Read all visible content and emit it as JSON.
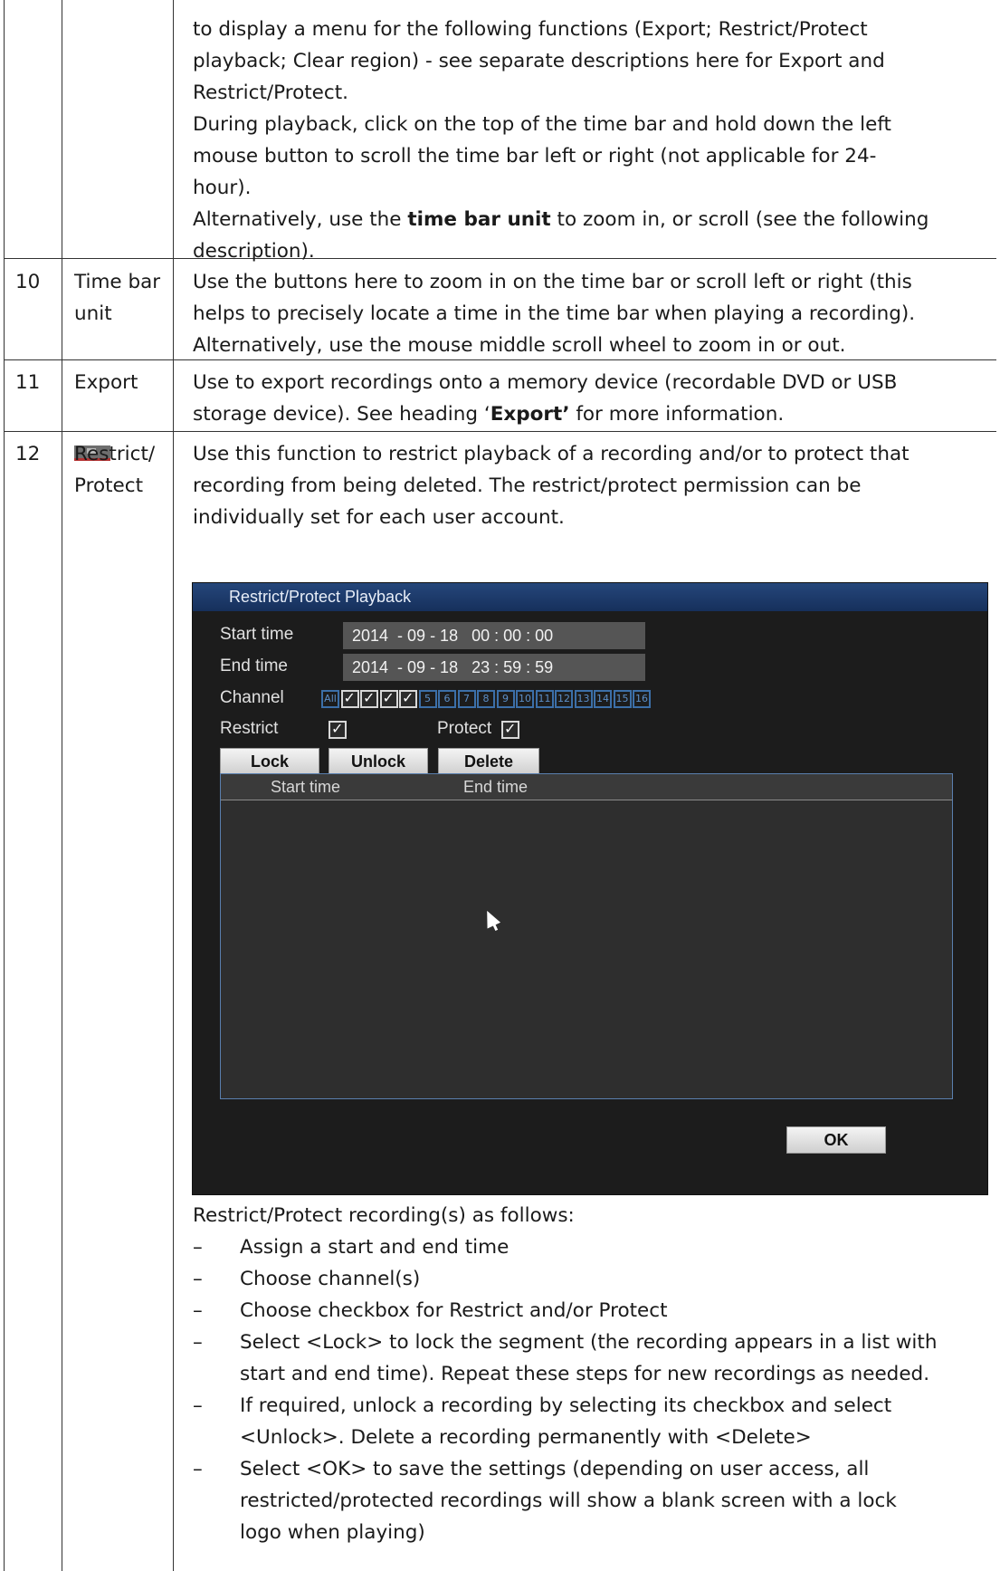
{
  "top_block": {
    "lines": [
      "to display a menu for the following functions (Export; Restrict/Protect",
      "playback; Clear region) - see separate descriptions here for Export and",
      "Restrict/Protect.",
      "During playback, click on the top of the time bar and hold down the left",
      "mouse button to scroll the time bar left or right (not applicable for 24-",
      "hour)."
    ],
    "alt_prefix": "Alternatively, use the ",
    "alt_bold": "time bar unit",
    "alt_suffix": " to zoom in, or scroll (see the following",
    "alt_line2": "description)."
  },
  "rows": [
    {
      "num": "10",
      "name": "Time bar unit",
      "lines": [
        "Use the buttons here to zoom in on the time bar or scroll left or right (this",
        "helps to precisely locate a time in the time bar when playing a recording).",
        "Alternatively, use the mouse middle scroll wheel to zoom in or out."
      ]
    },
    {
      "num": "11",
      "name": "Export",
      "icon": "export-icon",
      "line1": "Use to export recordings onto a memory device (recordable DVD or USB",
      "line2_prefix": "storage device). See heading ‘",
      "line2_bold": "Export’",
      "line2_suffix": " for more information."
    },
    {
      "num": "12",
      "name": "Restrict/ Protect",
      "lines": [
        "Use this function to restrict playback of a recording and/or to protect that",
        "recording from being deleted. The restrict/protect permission can be",
        "individually set for each user account."
      ]
    }
  ],
  "dialog": {
    "title": "Restrict/Protect Playback",
    "start_label": "Start time",
    "start_value": "2014  - 09 - 18   00 : 00 : 00",
    "end_label": "End time",
    "end_value": "2014  - 09 - 18   23 : 59 : 59",
    "channel_label": "Channel",
    "channel_all": "All",
    "channels_checked": 4,
    "channel_numbers": [
      "5",
      "6",
      "7",
      "8",
      "9",
      "10",
      "11",
      "12",
      "13",
      "14",
      "15",
      "16"
    ],
    "restrict_label": "Restrict",
    "restrict_checked": true,
    "protect_label": "Protect",
    "protect_checked": true,
    "lock_button": "Lock",
    "unlock_button": "Unlock",
    "delete_button": "Delete",
    "col_start": "Start time",
    "col_end": "End time",
    "ok_button": "OK"
  },
  "after_dialog": {
    "intro": "Restrict/Protect recording(s) as follows:",
    "bullets": [
      [
        "Assign a start and end time"
      ],
      [
        "Choose channel(s)"
      ],
      [
        "Choose checkbox for Restrict and/or Protect"
      ],
      [
        "Select <Lock> to lock the segment (the recording appears in a list with",
        "start and end time). Repeat these steps for new recordings as needed."
      ],
      [
        "If required, unlock a recording by selecting its checkbox and select",
        "<Unlock>. Delete a recording permanently with <Delete>"
      ],
      [
        "Select <OK> to save the settings (depending on user access, all",
        "restricted/protected recordings will show a blank screen with a lock",
        "logo when playing)"
      ]
    ],
    "dash": "–"
  }
}
